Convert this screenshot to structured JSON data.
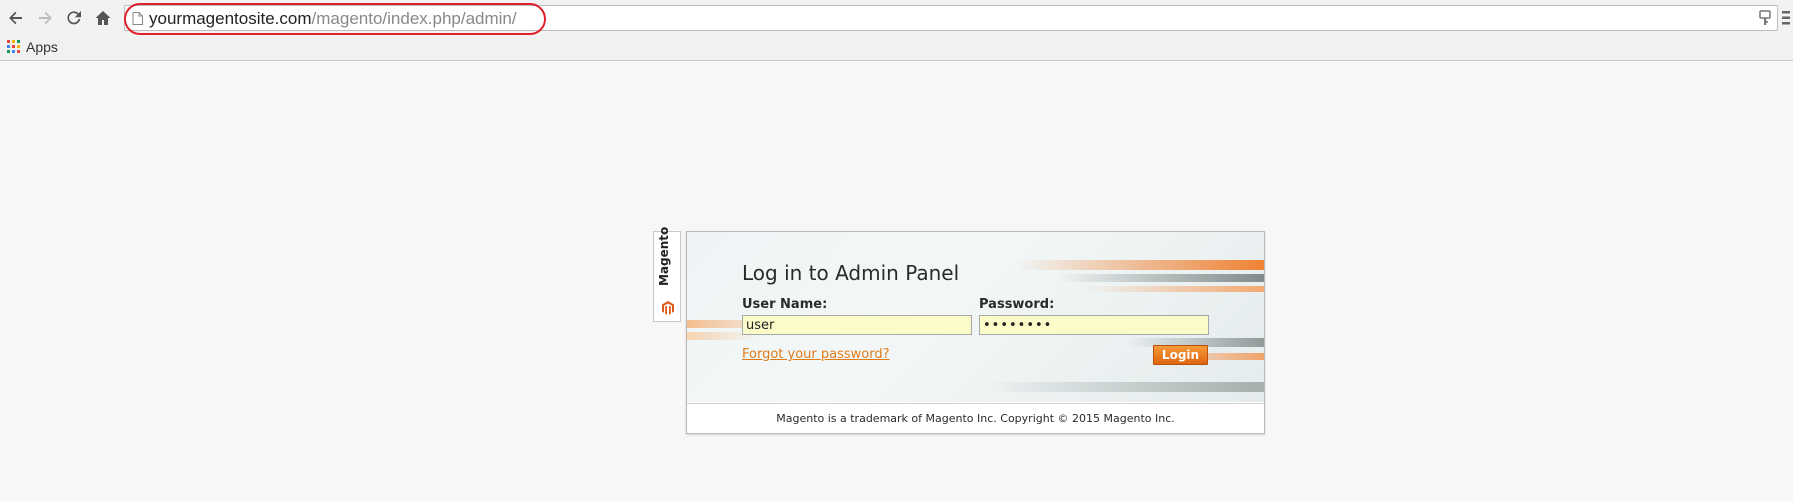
{
  "browser": {
    "url_host": "yourmagentosite.com",
    "url_path": "/magento/index.php/admin/",
    "bookmarks": [
      {
        "label": "Apps",
        "icon": "apps-grid-icon"
      }
    ],
    "annotation_color": "#e0202a"
  },
  "side_tab": {
    "label": "Magento",
    "icon": "magento-logo-icon"
  },
  "login": {
    "title": "Log in to Admin Panel",
    "username_label": "User Name:",
    "username_value": "user",
    "password_label": "Password:",
    "password_value": "••••••••",
    "forgot_link": "Forgot your password?",
    "login_button": "Login",
    "footer": "Magento is a trademark of Magento Inc. Copyright © 2015 Magento Inc."
  },
  "colors": {
    "accent": "#e07b1a",
    "input_bg": "#fafbc8",
    "page_bg": "#f7f7f7"
  }
}
